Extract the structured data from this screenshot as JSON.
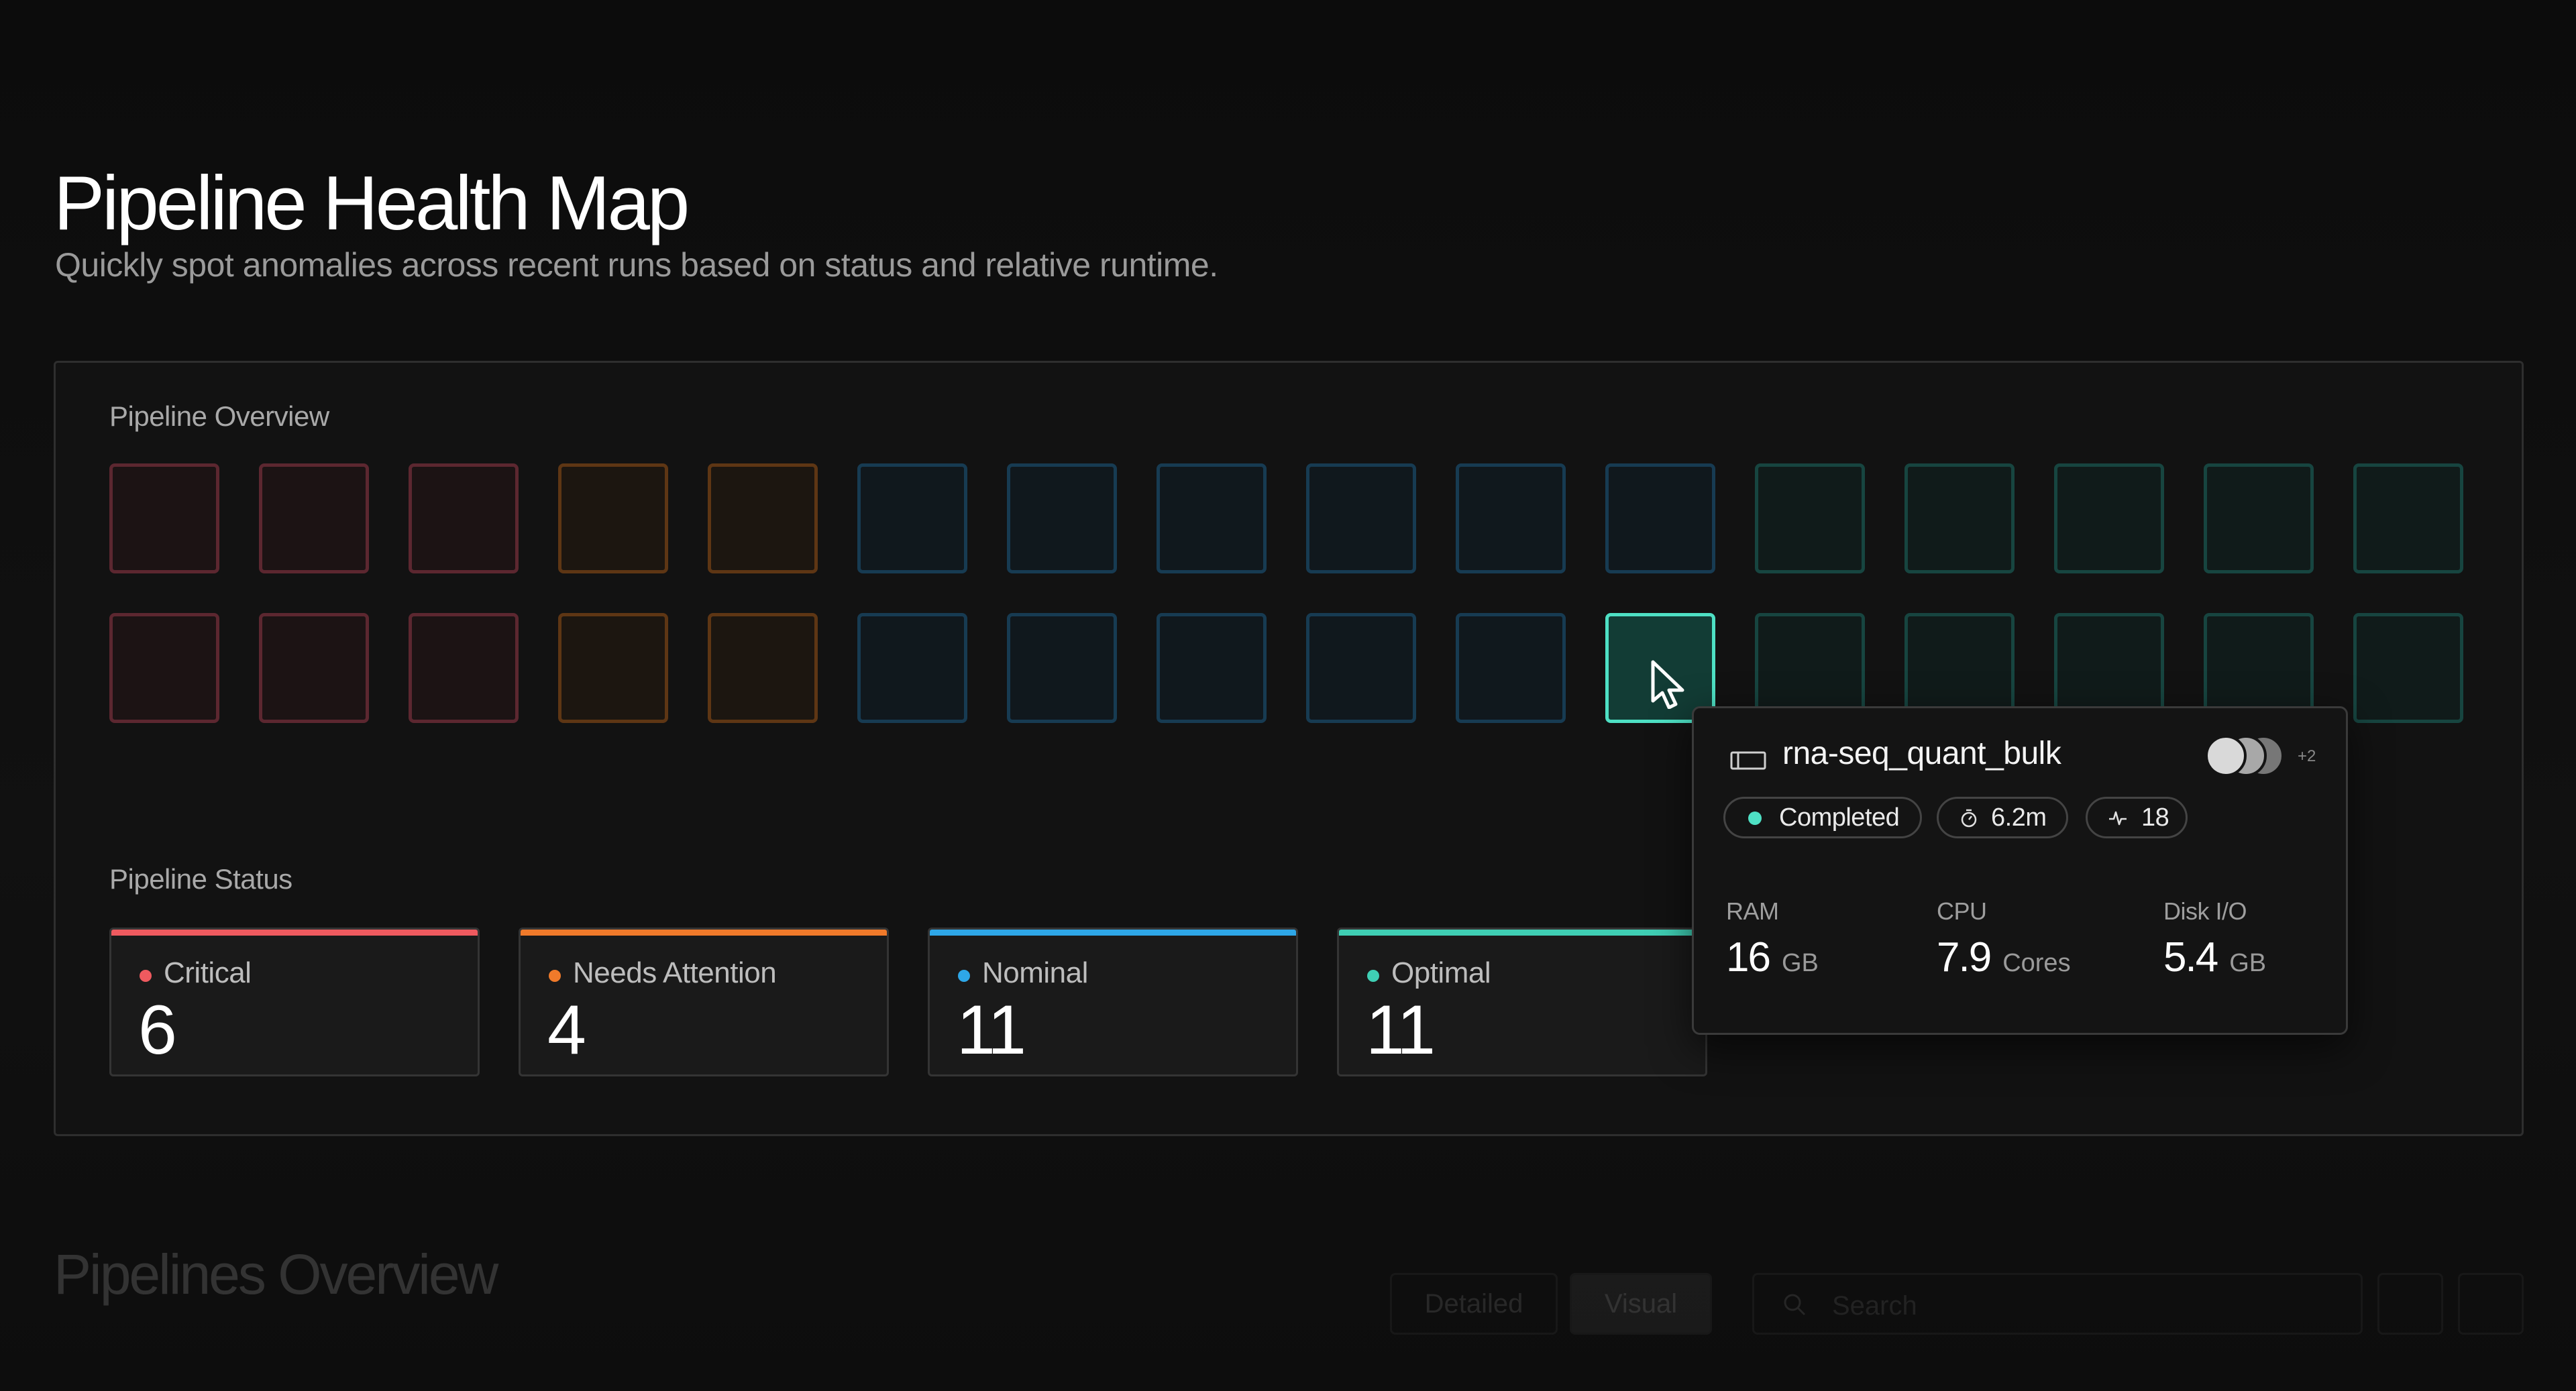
{
  "header": {
    "title": "Pipeline Health Map",
    "subtitle": "Quickly spot anomalies across recent runs based on status and relative runtime."
  },
  "overview": {
    "label": "Pipeline Overview",
    "cells": [
      [
        "critical",
        "critical",
        "critical",
        "attention",
        "attention",
        "nominal",
        "nominal",
        "nominal",
        "nominal",
        "nominal",
        "nominal",
        "optimal",
        "optimal",
        "optimal",
        "optimal",
        "optimal"
      ],
      [
        "critical",
        "critical",
        "critical",
        "attention",
        "attention",
        "nominal",
        "nominal",
        "nominal",
        "nominal",
        "nominal",
        "selected",
        "optimal",
        "optimal",
        "optimal",
        "optimal",
        "optimal"
      ]
    ]
  },
  "status": {
    "label": "Pipeline Status",
    "cards": [
      {
        "name": "Critical",
        "count": "6",
        "color": "#ef5a5f"
      },
      {
        "name": "Needs Attention",
        "count": "4",
        "color": "#f07a2a"
      },
      {
        "name": "Nominal",
        "count": "11",
        "color": "#2ea7e8"
      },
      {
        "name": "Optimal",
        "count": "11",
        "color": "#3fcfb4"
      }
    ]
  },
  "tooltip": {
    "pipeline_name": "rna-seq_quant_bulk",
    "more_avatars": "+2",
    "status": "Completed",
    "runtime": "6.2m",
    "runs": "18",
    "metrics": {
      "ram": {
        "label": "RAM",
        "value": "16",
        "unit": "GB"
      },
      "cpu": {
        "label": "CPU",
        "value": "7.9",
        "unit": "Cores"
      },
      "disk": {
        "label": "Disk I/O",
        "value": "5.4",
        "unit": "GB"
      }
    }
  },
  "below": {
    "title": "Pipelines Overview",
    "view_detailed": "Detailed",
    "view_visual": "Visual",
    "search_placeholder": "Search"
  },
  "icons": {
    "cursor": "pointer-cursor-icon",
    "pipeline": "pipeline-icon",
    "runtime": "stopwatch-icon",
    "runs": "activity-icon",
    "search": "search-icon"
  }
}
